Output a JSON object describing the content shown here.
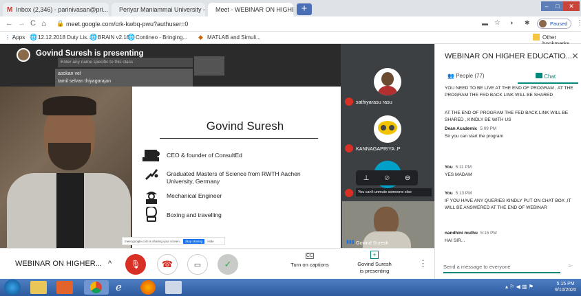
{
  "browser": {
    "tabs": [
      {
        "label": "Inbox (2,346) - parinivasan@pri..."
      },
      {
        "label": "Periyar Maniammai University - ..."
      },
      {
        "label": "Meet - WEBINAR ON HIGHE..."
      }
    ],
    "url": "meet.google.com/crk-kwbq-pwu?authuser=0",
    "profile_label": "Paused",
    "bookmarks": [
      {
        "label": "Apps"
      },
      {
        "label": "12.12.2018 Duty Lis..."
      },
      {
        "label": "BRAIN v2.16"
      },
      {
        "label": "Contineo - Bringing..."
      },
      {
        "label": "MATLAB and Simuli..."
      }
    ],
    "other_bookmarks": "Other bookmarks"
  },
  "meeting": {
    "presenter_banner": "Govind Suresh is presenting",
    "overlay": {
      "search_hint": "Enter any name specific to this class",
      "names": [
        "asokan vel",
        "tamil selvan thiyagarajan"
      ]
    },
    "slide": {
      "name": "Govind Suresh",
      "bullets": [
        {
          "icon": "ceo-icon",
          "text": "CEO & founder of ConsultEd"
        },
        {
          "icon": "graduate-icon",
          "text": "Graduated Masters of Science from RWTH Aachen University, Germany"
        },
        {
          "icon": "engineer-icon",
          "text": "Mechanical Engineer"
        },
        {
          "icon": "boxing-icon",
          "text": "Boxing and travelling"
        }
      ],
      "share_bar": {
        "text": "meet.google.com is sharing your screen.",
        "stop": "Stop sharing",
        "hide": "Hide"
      }
    },
    "participants": [
      {
        "name": "sathiyarasu rasu"
      },
      {
        "name": "KANNAGAPRIYA .P"
      },
      {
        "name": "Govind Suresh"
      }
    ],
    "unmute_tooltip": "You can't unmute someone else"
  },
  "chat": {
    "title": "WEBINAR ON HIGHER EDUCATIO...",
    "people_tab": "People (77)",
    "chat_tab": "Chat",
    "messages": [
      {
        "author": "",
        "time": "",
        "text": "YOU NEED TO BE LIVE AT THE END OF PROGRAM , AT THE PROGRAM  THE FED BACK LINK WILL BE SHARED"
      },
      {
        "author": "",
        "time": "",
        "text": "AT THE END OF  PROGRAM  THE FED BACK LINK WILL BE SHARED , KINDLY BE WITH US"
      },
      {
        "author": "Dean Academic",
        "time": "5:09 PM",
        "text": "Sir you can start the program"
      },
      {
        "author": "You",
        "time": "5:11 PM",
        "text": "YES MADAM"
      },
      {
        "author": "You",
        "time": "5:13 PM",
        "text": "IF YOU HAVE ANY QUERIES KINDLY PUT ON CHAT BOX ,IT WILL BE ANSWERED AT THE END OF WEBINAR"
      },
      {
        "author": "nandhini muthu",
        "time": "5:15 PM",
        "text": "HAI SIR..."
      }
    ],
    "input_placeholder": "Send a message to everyone"
  },
  "controls": {
    "meeting_title": "WEBINAR ON HIGHER...",
    "captions_label": "Turn on captions",
    "presenting_label": "Govind Suresh\nis presenting"
  },
  "taskbar": {
    "time": "5:15 PM",
    "date": "9/10/2020"
  },
  "colors": {
    "mic_off_red": "#d93025",
    "accept_green": "#34a853",
    "chat_green": "#00897b",
    "meet_dark": "#3c4043"
  }
}
